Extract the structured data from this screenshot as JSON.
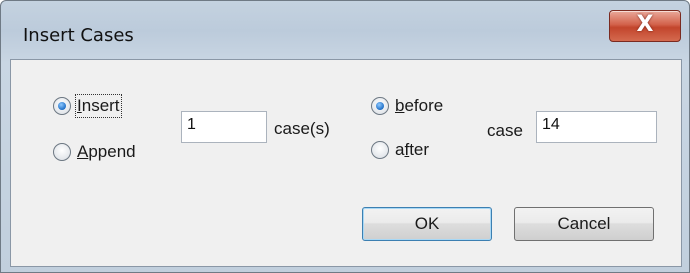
{
  "dialog": {
    "title": "Insert Cases",
    "close_label": "X"
  },
  "mode": {
    "insert_prefix": "",
    "insert_mnemonic": "I",
    "insert_rest": "nsert",
    "append_mnemonic": "A",
    "append_rest": "ppend",
    "selected": "Insert"
  },
  "count": {
    "value": "1",
    "suffix": "case(s)"
  },
  "position": {
    "before_mnemonic": "b",
    "before_rest": "efore",
    "after_prefix": "a",
    "after_mnemonic": "f",
    "after_rest": "ter",
    "selected": "before"
  },
  "target": {
    "label": "case",
    "value": "14"
  },
  "buttons": {
    "ok": "OK",
    "cancel": "Cancel"
  }
}
